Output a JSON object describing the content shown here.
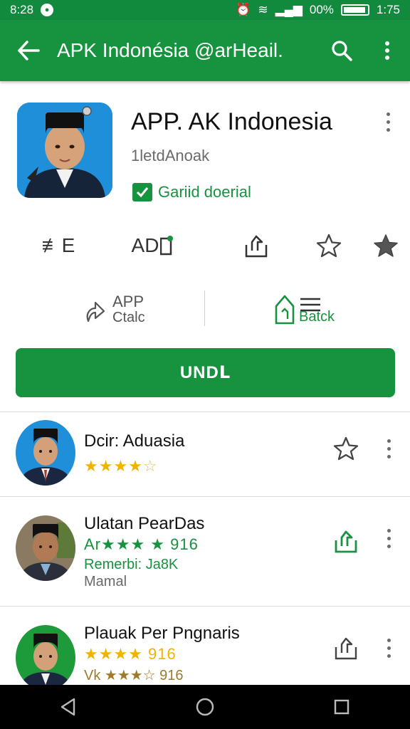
{
  "status_bar": {
    "time": "8:28",
    "battery": "00%",
    "clock_right": "1:75"
  },
  "app_bar": {
    "title": "APK Indonésia @arHeail.",
    "icons": [
      "back-arrow-icon",
      "search-icon",
      "more-vert-icon"
    ]
  },
  "app": {
    "name": "APP. AK Indonesia",
    "developer": "1letdAnoak",
    "badge": "Gariid doerial",
    "colors": {
      "accent": "#17923f",
      "icon_bg": "#1f8fd9"
    }
  },
  "icon_row": {
    "left_label": "≢E",
    "ad_label": "AD"
  },
  "categories": [
    {
      "icon": "app-arrow-icon",
      "line1": "APP",
      "line2": "Ctalc"
    },
    {
      "icon": "home-list-icon",
      "line1": "",
      "line2": "Batck"
    }
  ],
  "install_label": "UNDⅬ",
  "list": [
    {
      "name": "Dcir: Aduasia",
      "stars": 4,
      "stars_text": "",
      "sub": "",
      "action_icon": "star-outline-icon",
      "avatar_bg": "#1f8fd9"
    },
    {
      "name": "Ulatan PearDas",
      "stars_text": "Ar★★★ ★ 916",
      "sub_green": "Remerbi: Ja8K",
      "sub": "Mamal",
      "action_icon": "share-icon",
      "avatar_bg": "#7a6a55"
    },
    {
      "name": "Plauak Per Pngnaris",
      "stars_text": "★★★★ 916",
      "sub": "Vk ★★★☆ 916",
      "action_icon": "share-outline-icon",
      "avatar_bg": "#1d9a3a"
    }
  ]
}
